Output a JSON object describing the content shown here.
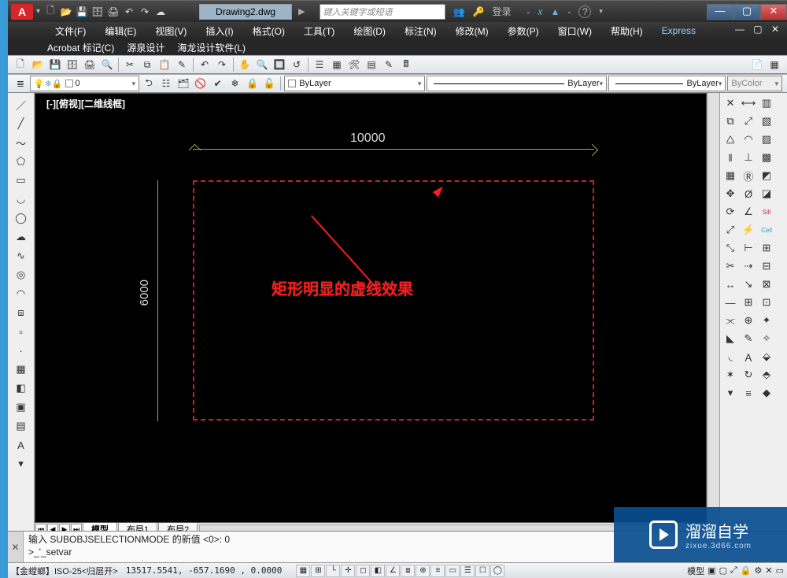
{
  "title": {
    "filename": "Drawing2.dwg",
    "search_placeholder": "键入关键字或短语",
    "login": "登录"
  },
  "menu1": [
    "文件(F)",
    "编辑(E)",
    "视图(V)",
    "插入(I)",
    "格式(O)",
    "工具(T)",
    "绘图(D)",
    "标注(N)",
    "修改(M)",
    "参数(P)",
    "窗口(W)",
    "帮助(H)",
    "Express"
  ],
  "menu2": [
    "Acrobat 标记(C)",
    "源泉设计",
    "海龙设计软件(L)"
  ],
  "layers": {
    "current": "0",
    "linetype": "ByLayer",
    "lineweight": "ByLayer",
    "plotstyle": "ByLayer",
    "colorheader": "ByColor"
  },
  "viewport": {
    "view_label": "[-][俯视][二维线框]",
    "dim_h": "10000",
    "dim_v": "6000",
    "annotation": "矩形明显的虚线效果"
  },
  "layout_tabs": {
    "model": "模型",
    "l1": "布局1",
    "l2": "布局2"
  },
  "cmd": {
    "line1": "输入 SUBOBJSELECTIONMODE 的新值 <0>: 0",
    "line2": ">_'_setvar"
  },
  "status": {
    "leftinfo": "【金螳螂】ISO-25<归层开>",
    "coords": "13517.5541, -657.1690 , 0.0000",
    "model_label": "模型"
  },
  "watermark": {
    "brand": "溜溜自学",
    "url": "zixue.3d66.com"
  },
  "icons": {
    "new": "🗋",
    "open": "📂",
    "save": "💾",
    "saveall": "🗄",
    "print": "🖨",
    "undo": "↶",
    "redo": "↷",
    "cloud": "☁",
    "people": "👥",
    "key": "🔑",
    "exchange": "x",
    "a": "▲",
    "help": "?",
    "drop": "▾",
    "line": "／",
    "pline": "～",
    "circle": "◯",
    "arc": "◡",
    "rect": "▭",
    "poly": "⬠",
    "ellipse": "◎",
    "spline": "∿",
    "cloudr": "☁",
    "hatch": "▦",
    "point": "·",
    "region": "▣",
    "table": "▤",
    "text": "A",
    "move": "✥",
    "copy": "⧉",
    "mirror": "⧋",
    "offset": "‖",
    "array": "▦",
    "rotate": "⟳",
    "scale": "⤢",
    "trim": "✂",
    "extend": "↔",
    "break": "—",
    "fillet": "◟",
    "explode": "✶",
    "erase": "✕",
    "pdf": "📄",
    "layer": "≣",
    "bulb": "💡",
    "freeze": "❄",
    "lock": "🔒",
    "color": "■",
    "match": "✎",
    "zoom": "🔍",
    "pan": "✋",
    "orbit": "⭯"
  }
}
